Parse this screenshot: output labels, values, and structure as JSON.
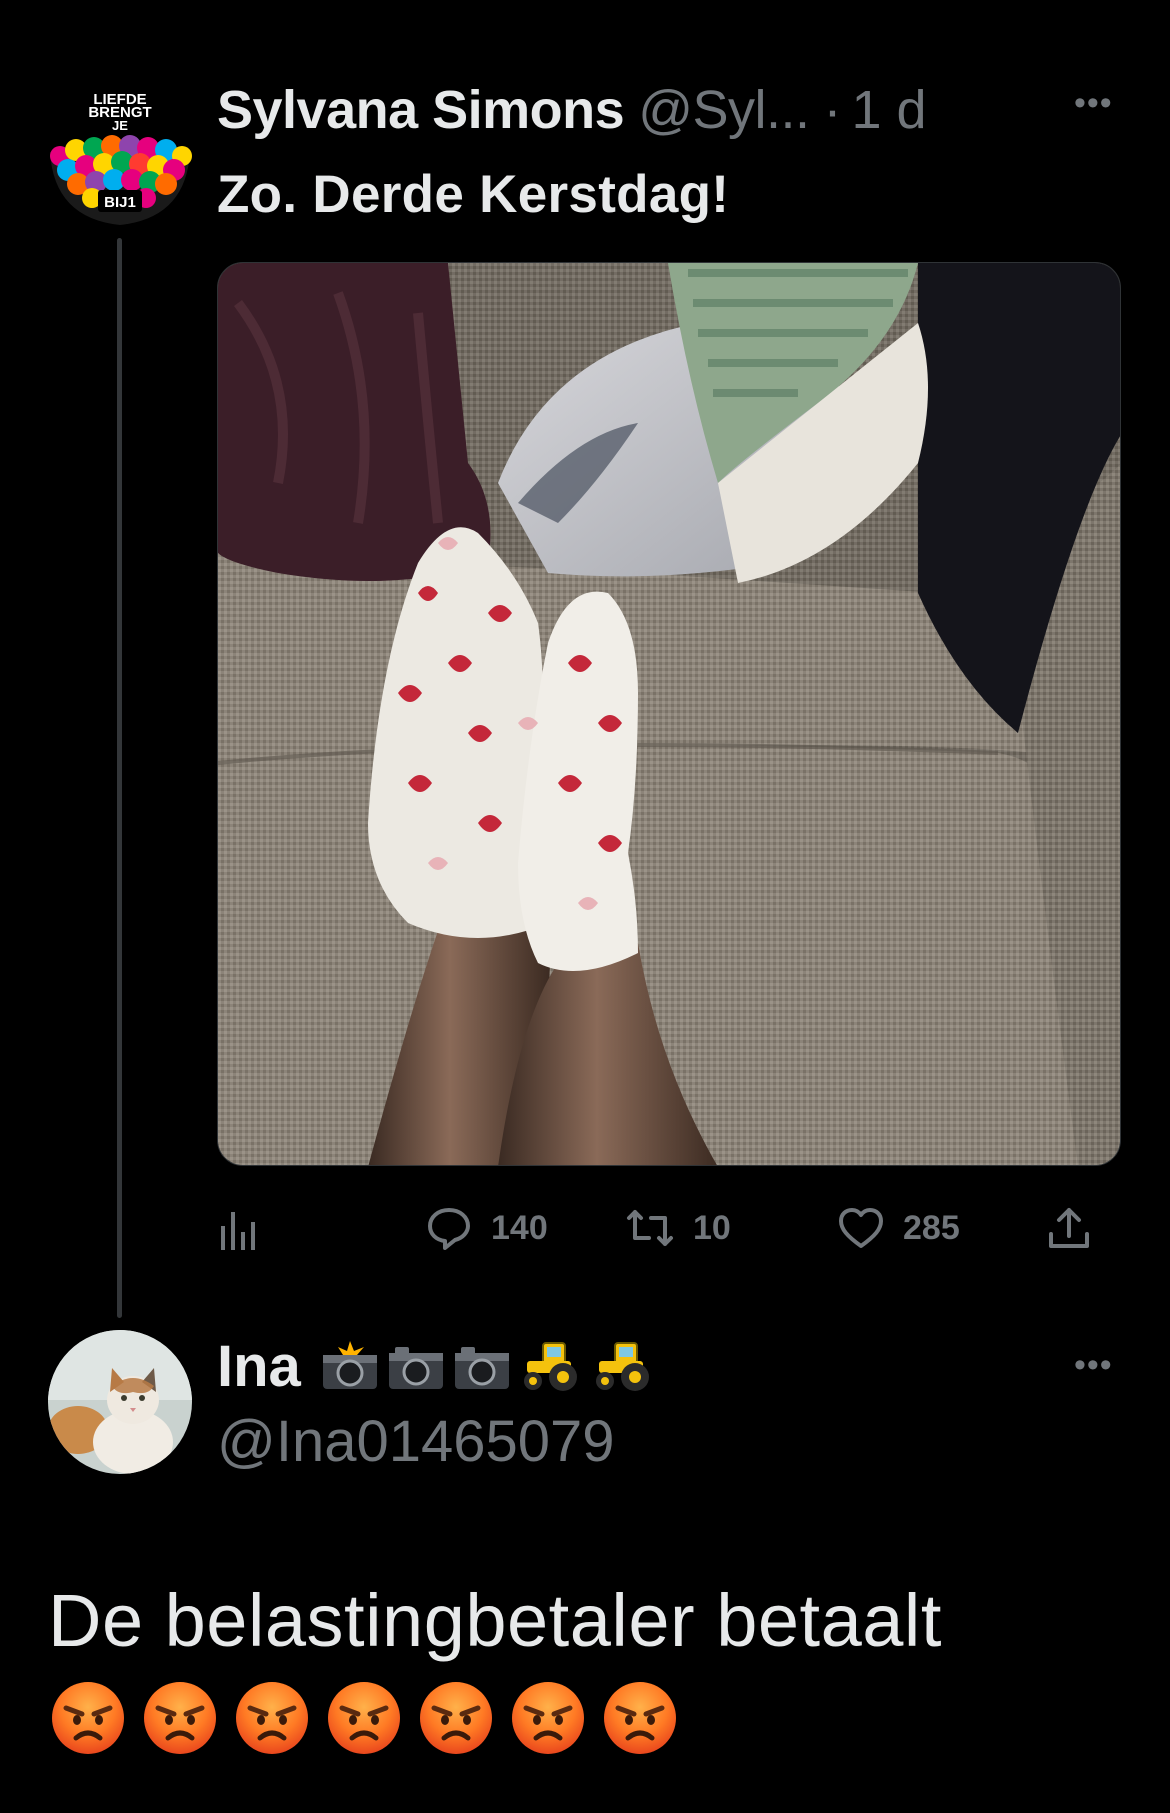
{
  "tweet": {
    "author_name": "Sylvana Simons",
    "author_handle": "@Syl...",
    "separator": "·",
    "time": "1 d",
    "text": "Zo. Derde Kerstdag!",
    "avatar_text": [
      "LIEFDE",
      "BRENGT",
      "JE",
      "BIJ1"
    ],
    "stats": {
      "replies": "140",
      "retweets": "10",
      "likes": "285"
    },
    "icons": [
      "views-icon",
      "reply-icon",
      "retweet-icon",
      "like-icon",
      "share-icon",
      "more-icon"
    ]
  },
  "reply": {
    "author_name": "Ina",
    "name_emojis": [
      "camera-flash-emoji",
      "camera-emoji",
      "camera-emoji",
      "tractor-emoji",
      "tractor-emoji"
    ],
    "author_handle": "@Ina01465079",
    "text": "De belastingbetaler betaalt",
    "angry_emoji_count": 7,
    "icons": [
      "more-icon"
    ]
  },
  "colors": {
    "background": "#000000",
    "text": "#e7e9ea",
    "muted": "#71767b"
  }
}
